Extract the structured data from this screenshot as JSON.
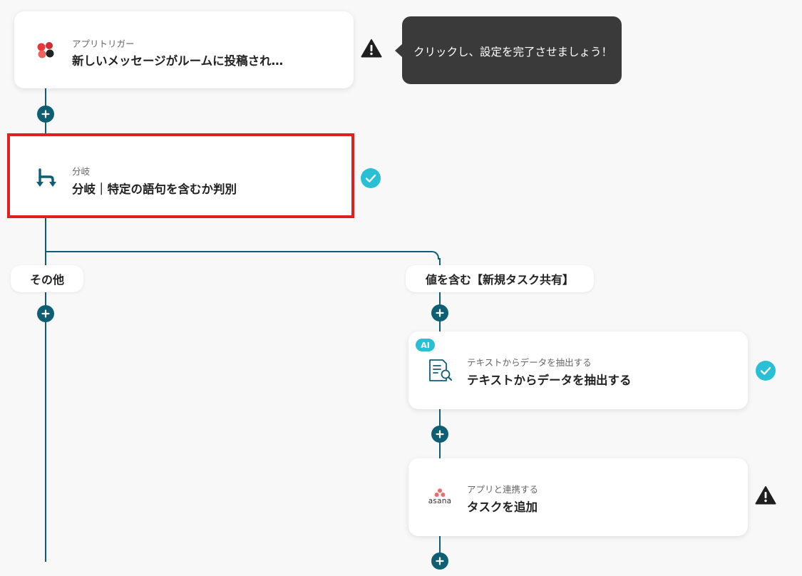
{
  "trigger": {
    "sub_label": "アプリトリガー",
    "title": "新しいメッセージがルームに投稿され…",
    "icon": "chatwork-logo-icon",
    "status": "warning"
  },
  "tooltip": {
    "text": "クリックし、設定を完了させましょう！"
  },
  "branch_step": {
    "sub_label": "分岐",
    "title": "分岐｜特定の語句を含むか判別",
    "icon": "branch-icon",
    "status": "complete"
  },
  "branches": {
    "left_label": "その他",
    "right_label": "値を含む【新規タスク共有】"
  },
  "extract_step": {
    "badge": "AI",
    "sub_label": "テキストからデータを抽出する",
    "title": "テキストからデータを抽出する",
    "icon": "document-search-icon",
    "status": "complete"
  },
  "asana_step": {
    "sub_label": "アプリと連携する",
    "title": "タスクを追加",
    "logo_text": "asana",
    "icon": "asana-logo-icon",
    "status": "warning"
  },
  "colors": {
    "connector": "#0f5f74",
    "check": "#29c0d6",
    "highlight": "#e02020",
    "asana": "#f06a6a"
  }
}
